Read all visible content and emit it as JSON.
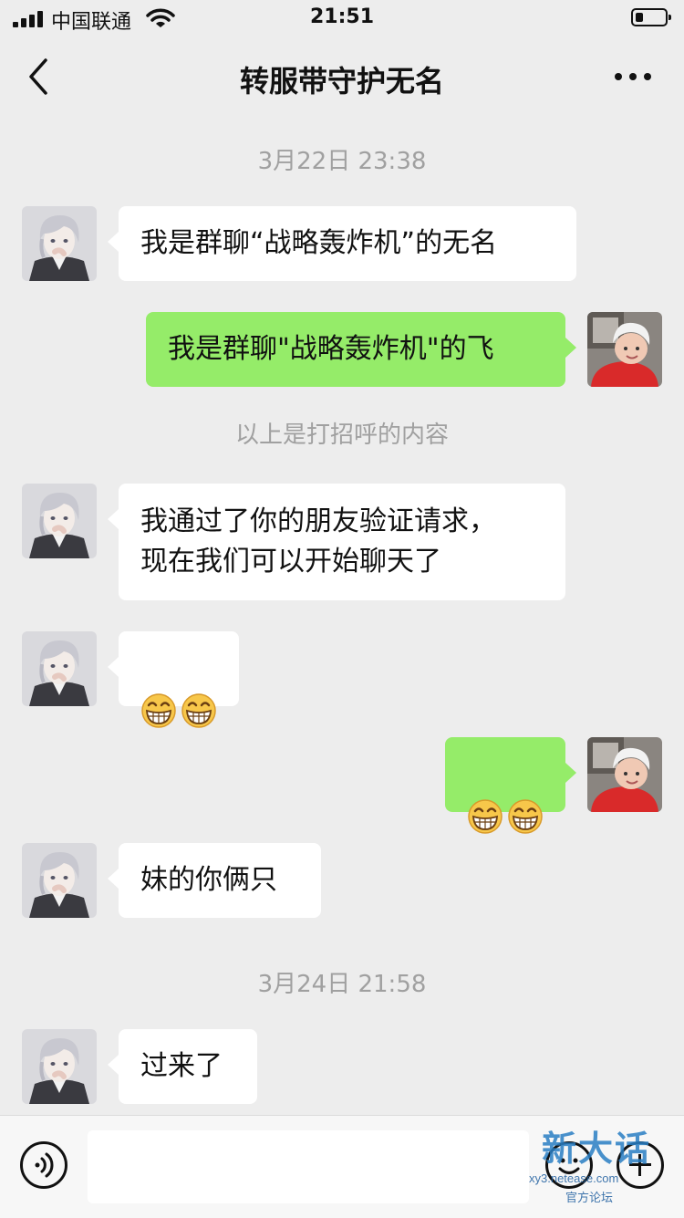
{
  "status_bar": {
    "carrier": "中国联通",
    "time": "21:51"
  },
  "nav": {
    "title": "转服带守护无名",
    "back_icon": "chevron-left-icon",
    "more_icon": "ellipsis-icon"
  },
  "messages": {
    "ts1": "3月22日 23:38",
    "m1": "我是群聊“战略轰炸机”的无名",
    "m2": "我是群聊\"战略轰炸机\"的飞",
    "sys1": "以上是打招呼的内容",
    "m3": "我通过了你的朋友验证请求，\n现在我们可以开始聊天了",
    "m6": "妹的你俩只",
    "ts2": "3月24日 21:58",
    "m7": "过来了"
  },
  "input_bar": {
    "voice_icon": "voice-icon",
    "emoji_icon": "emoji-icon",
    "plus_icon": "plus-icon"
  },
  "watermark": {
    "title": "新大话",
    "url": "xy3.netease.com",
    "sub": "官方论坛"
  },
  "colors": {
    "background": "#ededed",
    "incoming_bubble": "#ffffff",
    "outgoing_bubble": "#95ec69",
    "timestamp": "#a0a0a0"
  }
}
